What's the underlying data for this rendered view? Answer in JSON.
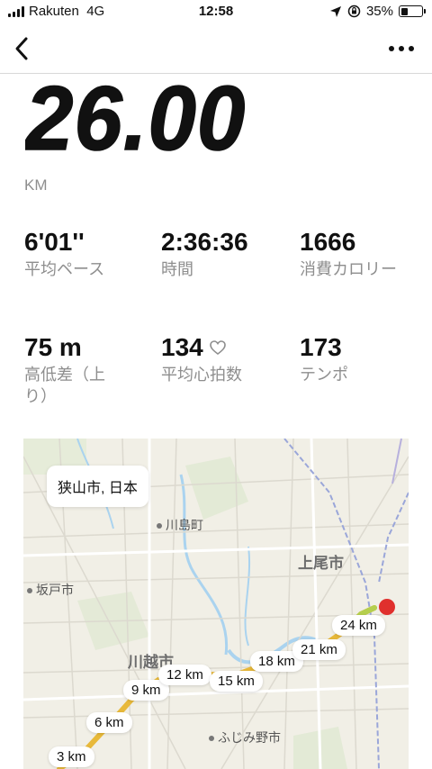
{
  "status_bar": {
    "carrier": "Rakuten",
    "network": "4G",
    "time": "12:58",
    "battery": "35%",
    "battery_level": 0.35
  },
  "nav": {
    "back_icon": "chevron-left-icon",
    "more_icon": "more-dots-icon"
  },
  "summary": {
    "distance": "26.00",
    "distance_unit": "KM"
  },
  "stats": {
    "avg_pace": {
      "value": "6'01''",
      "label": "平均ペース"
    },
    "duration": {
      "value": "2:36:36",
      "label": "時間"
    },
    "calories": {
      "value": "1666",
      "label": "消費カロリー"
    },
    "elevation": {
      "value": "75 m",
      "label": "高低差（上り）"
    },
    "avg_heart_rate": {
      "value": "134",
      "label": "平均心拍数",
      "icon": "heart-outline-icon"
    },
    "cadence": {
      "value": "173",
      "label": "テンポ"
    }
  },
  "map": {
    "location": "狭山市, 日本",
    "places": {
      "kawajima": "川島町",
      "ageo": "上尾市",
      "sakado": "坂戸市",
      "kawagoe": "川越市",
      "fujimino": "ふじみ野市"
    },
    "km_markers": [
      "3 km",
      "6 km",
      "9 km",
      "12 km",
      "15 km",
      "18 km",
      "21 km",
      "24 km"
    ],
    "route_color": "#e8b93a",
    "end_pin_color": "#e0302d"
  }
}
